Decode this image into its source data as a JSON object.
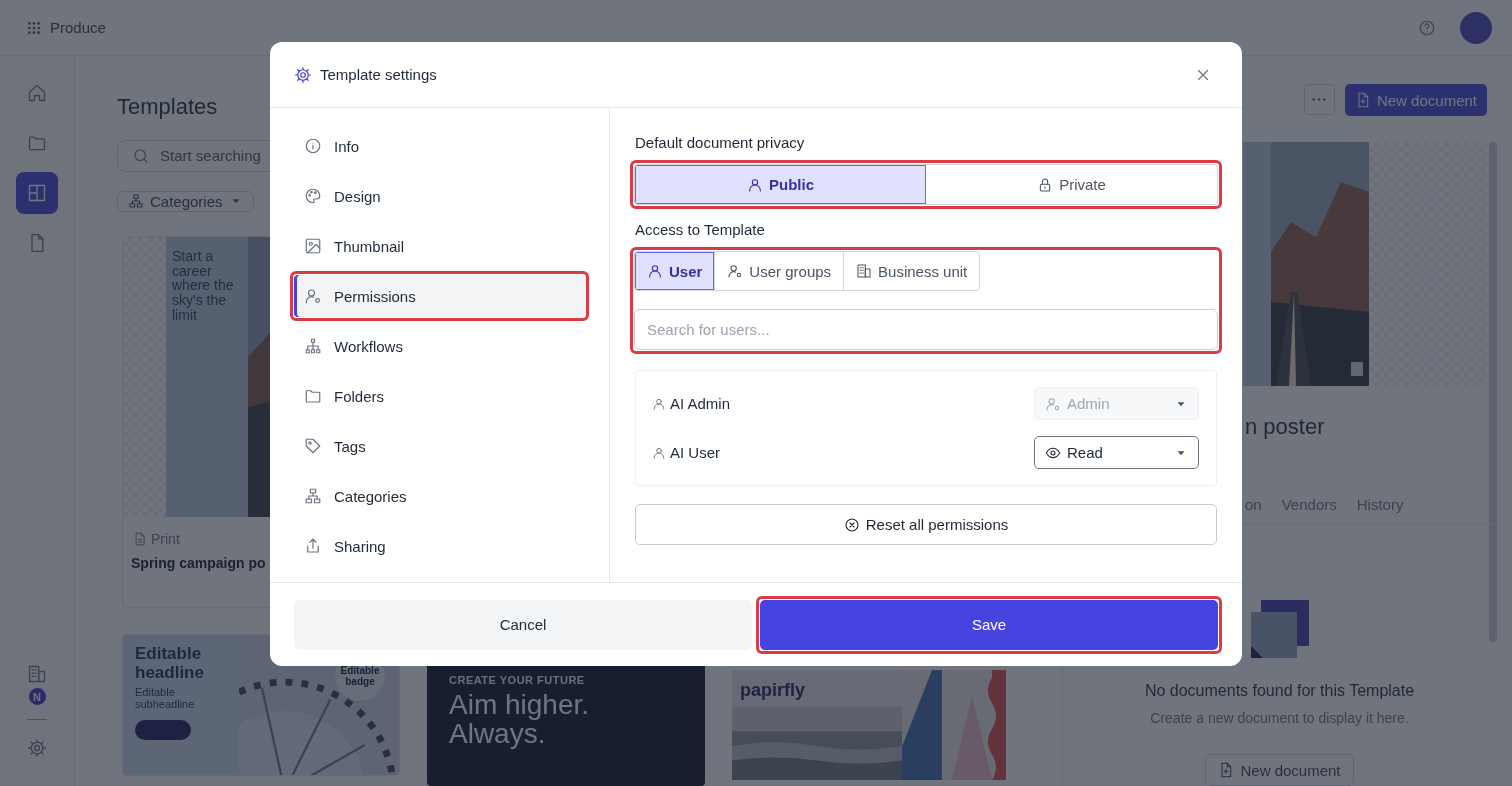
{
  "app": {
    "name": "Produce"
  },
  "rail": {
    "items": [
      {
        "selected": false
      },
      {
        "selected": false
      },
      {
        "selected": true
      },
      {
        "selected": false
      }
    ],
    "badge": "N"
  },
  "page": {
    "title": "Templates",
    "search_placeholder": "Start searching",
    "filter": "Categories"
  },
  "cards_row_1": [
    {
      "poster_text": "Start a career where the sky's the limit",
      "type": "Print",
      "title": "Spring campaign po"
    }
  ],
  "cards_row_2": [
    {
      "kind": "headline",
      "headline": "Editable headline",
      "subheadline": "Editable subheadline",
      "badge": "Editable badge"
    },
    {
      "kind": "dark",
      "eyebrow": "CREATE YOUR FUTURE",
      "headline": "Aim higher. Always."
    },
    {
      "kind": "brand",
      "logo": "papirfly"
    }
  ],
  "detail": {
    "new_document": "New document",
    "title": "n poster",
    "tabs": [
      {
        "label": "on",
        "selected": false
      },
      {
        "label": "Vendors",
        "selected": false
      },
      {
        "label": "History",
        "selected": false
      }
    ],
    "empty_title": "No documents found for this Template",
    "empty_text": "Create a new document to display it here.",
    "empty_button": "New document"
  },
  "dialog": {
    "title": "Template settings",
    "nav": [
      {
        "label": "Info",
        "selected": false,
        "highlighted": false
      },
      {
        "label": "Design",
        "selected": false,
        "highlighted": false
      },
      {
        "label": "Thumbnail",
        "selected": false,
        "highlighted": false
      },
      {
        "label": "Permissions",
        "selected": true,
        "highlighted": true
      },
      {
        "label": "Workflows",
        "selected": false,
        "highlighted": false
      },
      {
        "label": "Folders",
        "selected": false,
        "highlighted": false
      },
      {
        "label": "Tags",
        "selected": false,
        "highlighted": false
      },
      {
        "label": "Categories",
        "selected": false,
        "highlighted": false
      },
      {
        "label": "Sharing",
        "selected": false,
        "highlighted": false
      }
    ],
    "privacy": {
      "label": "Default document privacy",
      "highlighted": true,
      "options": [
        {
          "label": "Public",
          "selected": true
        },
        {
          "label": "Private",
          "selected": false
        }
      ]
    },
    "access": {
      "label": "Access to Template",
      "highlighted": true,
      "tabs": [
        {
          "label": "User",
          "selected": true
        },
        {
          "label": "User groups",
          "selected": false
        },
        {
          "label": "Business unit",
          "selected": false
        }
      ],
      "search_placeholder": "Search for users..."
    },
    "users": [
      {
        "name": "AI Admin",
        "role": "Admin",
        "disabled": true
      },
      {
        "name": "AI User",
        "role": "Read",
        "disabled": false
      }
    ],
    "reset_button": "Reset all permissions",
    "buttons": [
      {
        "label": "Cancel",
        "kind": "secondary",
        "highlighted": false
      },
      {
        "label": "Save",
        "kind": "primary",
        "highlighted": true
      }
    ]
  }
}
